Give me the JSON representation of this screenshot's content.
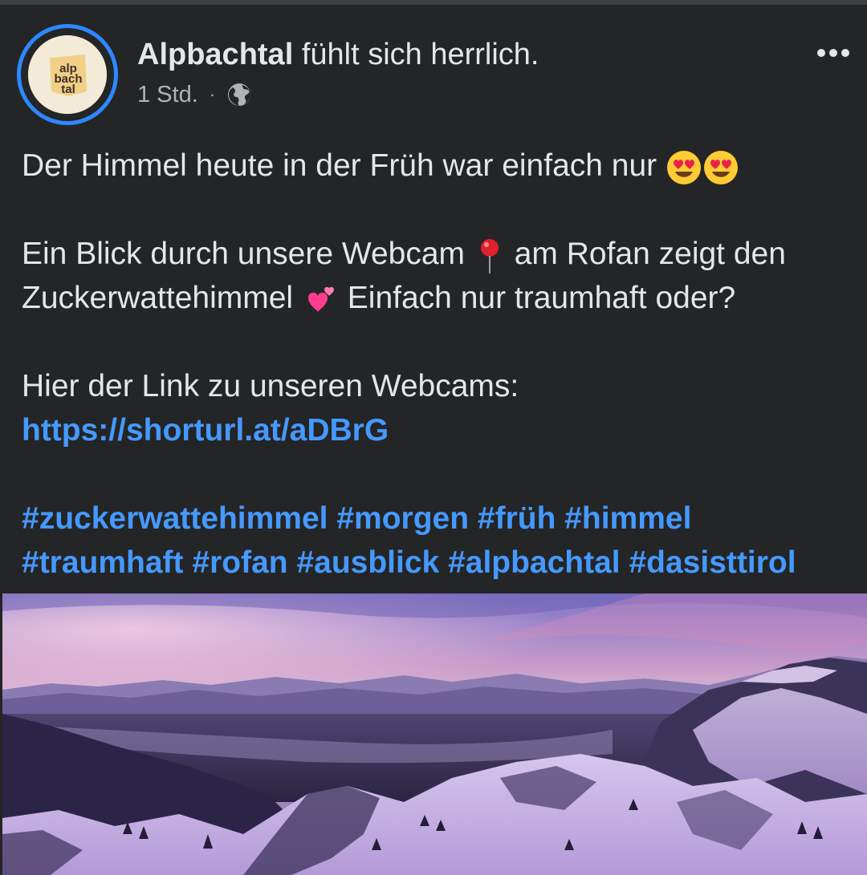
{
  "post": {
    "author": "Alpbachtal",
    "feeling": "fühlt sich herrlich.",
    "time": "1 Std.",
    "separator": "·",
    "privacy_icon": "globe-icon",
    "more_icon": "more-options-icon",
    "avatar_text": [
      "alp",
      "bach",
      "tal"
    ],
    "body": {
      "line1": "Der Himmel heute in der Früh war einfach nur",
      "line1_emojis": [
        "heart-eyes-emoji",
        "heart-eyes-emoji"
      ],
      "para2_a": "Ein Blick durch unsere Webcam",
      "para2_pin_emoji": "round-pushpin-emoji",
      "para2_b": "am Rofan zeigt den Zuckerwattehimmel",
      "para2_heart_emoji": "two-hearts-emoji",
      "para2_c": "Einfach nur traumhaft oder?",
      "para3": "Hier der Link zu unseren Webcams:",
      "link": "https://shorturl.at/aDBrG",
      "hashtags": [
        "#zuckerwattehimmel",
        "#morgen",
        "#früh",
        "#himmel",
        "#traumhaft",
        "#rofan",
        "#ausblick",
        "#alpbachtal",
        "#dasisttirol"
      ]
    }
  },
  "colors": {
    "background": "#242526",
    "text": "#e4e6eb",
    "secondary_text": "#b0b3b8",
    "link": "#4599ff",
    "avatar_ring": "#2d88ff"
  }
}
